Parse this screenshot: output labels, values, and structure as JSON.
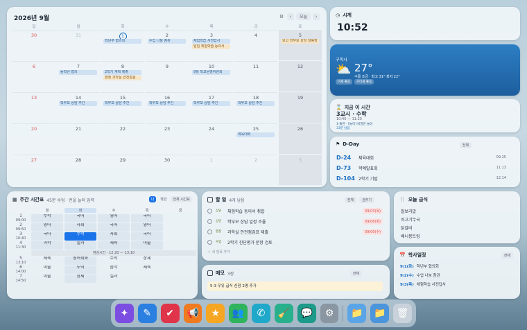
{
  "calendar": {
    "title": "2026년 9월",
    "today_label": "오늘",
    "weekdays": [
      "일",
      "월",
      "화",
      "수",
      "목",
      "금",
      "토"
    ],
    "weeks": [
      [
        {
          "n": "30",
          "dim": true
        },
        {
          "n": "31",
          "dim": true
        },
        {
          "n": "1",
          "today": true,
          "ev": [
            {
              "t": "학년부 협의회",
              "c": "b"
            }
          ]
        },
        {
          "n": "2",
          "ev": [
            {
              "t": "수업 나눔 참관",
              "c": "b"
            }
          ]
        },
        {
          "n": "3",
          "ev": [
            {
              "t": "체험학습 사전답사",
              "c": "b"
            },
            {
              "t": "답임 체험학습 동의서",
              "c": "o"
            }
          ]
        },
        {
          "n": "4"
        },
        {
          "n": "5",
          "ev": [
            {
              "t": "보고 학부모 상담 알림장",
              "c": "o"
            }
          ]
        }
      ],
      [
        {
          "n": "6"
        },
        {
          "n": "7",
          "ev": [
            {
              "t": "동학년 협의",
              "c": "b"
            }
          ]
        },
        {
          "n": "8",
          "ev": [
            {
              "t": "2학기 계획 제출",
              "c": "b"
            },
            {
              "t": "행정 과학실 안전점검",
              "c": "o"
            }
          ]
        },
        {
          "n": "9"
        },
        {
          "n": "10",
          "ev": [
            {
              "t": "9월 학교운영위원회",
              "c": "b"
            }
          ]
        },
        {
          "n": "11"
        },
        {
          "n": "12"
        }
      ],
      [
        {
          "n": "13"
        },
        {
          "n": "14",
          "ev": [
            {
              "t": "학부모 상담 주간",
              "c": "b"
            }
          ]
        },
        {
          "n": "15",
          "ev": [
            {
              "t": "학부모 상담 주간",
              "c": "b"
            }
          ]
        },
        {
          "n": "16",
          "ev": [
            {
              "t": "학부모 상담 주간",
              "c": "b"
            }
          ]
        },
        {
          "n": "17",
          "ev": [
            {
              "t": "학부모 상담 주간",
              "c": "b"
            }
          ]
        },
        {
          "n": "18",
          "ev": [
            {
              "t": "학부모 상담 주간",
              "c": "b"
            }
          ]
        },
        {
          "n": "19"
        }
      ],
      [
        {
          "n": "20"
        },
        {
          "n": "21"
        },
        {
          "n": "22"
        },
        {
          "n": "23"
        },
        {
          "n": "24"
        },
        {
          "n": "25",
          "ev": [
            {
              "t": "체육대회",
              "c": "b"
            }
          ]
        },
        {
          "n": "26"
        }
      ],
      [
        {
          "n": "27"
        },
        {
          "n": "28"
        },
        {
          "n": "29"
        },
        {
          "n": "30"
        },
        {
          "n": "1",
          "dim": true
        },
        {
          "n": "2",
          "dim": true
        },
        {
          "n": "3",
          "dim": true
        }
      ]
    ]
  },
  "clock": {
    "title": "시계",
    "time": "10:52"
  },
  "weather": {
    "city": "구미시",
    "temp": "27°",
    "desc": "구름 조금 · 최고 31° 최저 22°",
    "chips": [
      "미세 좋음",
      "초미세 좋음"
    ]
  },
  "now": {
    "title": "지금 이 시간",
    "period": "3교시 · 수학",
    "range": "10:40 — 11:25",
    "note": "1-통만 · [놀이] 비밀번 놀이",
    "remain": "33분 남음"
  },
  "dday": {
    "title": "D-Day",
    "btn": "전체",
    "items": [
      {
        "d": "D-24",
        "name": "체육대회",
        "date": "09.25"
      },
      {
        "d": "D-73",
        "name": "학예발표회",
        "date": "11.13"
      },
      {
        "d": "D-104",
        "name": "2학기 기말",
        "date": "12.14"
      }
    ]
  },
  "timetable": {
    "title": "주간 시간표",
    "sub": "45분 수업 · 컨을 눌러 입력",
    "tabs": [
      "나",
      "학반",
      "전체 시간표"
    ],
    "days": [
      "월",
      "화",
      "수",
      "목",
      "금"
    ],
    "periods": [
      "1",
      "2",
      "3",
      "4",
      "5",
      "6",
      "7"
    ],
    "times": [
      "09:00",
      "09:50",
      "10:40",
      "11:30",
      "13:10",
      "14:00",
      "14:50"
    ],
    "rows": [
      [
        "수학",
        "국어",
        "영어",
        "국어",
        ""
      ],
      [
        "영어",
        "사회",
        "국어",
        "영어",
        ""
      ],
      [
        "국어",
        "수학",
        "사회",
        "국어",
        ""
      ],
      [
        "과학",
        "실과",
        "체육",
        "미술",
        ""
      ],
      [
        "체육",
        "영어회화",
        "수학",
        "창체",
        ""
      ],
      [
        "미술",
        "도덕",
        "음악",
        "체육",
        ""
      ],
      [
        "미술",
        "창체",
        "실과",
        "",
        ""
      ]
    ],
    "lunch": "점심시간 · 12:20 — 13:10"
  },
  "todo": {
    "title": "할 일",
    "count": "4개 남음",
    "btns": [
      "전체",
      "검추기"
    ],
    "items": [
      {
        "tag": "상담",
        "text": "체험학습 동의서 취합",
        "date": "09/03(목)"
      },
      {
        "tag": "상담",
        "text": "학부모 상담 일정 조율",
        "date": "09/08(화)"
      },
      {
        "tag": "행정",
        "text": "과학실 안전점검표 제출",
        "date": "09/09(수)"
      },
      {
        "tag": "수업",
        "text": "2학기 진단평가 문항 검토",
        "date": ""
      }
    ],
    "add": "새 항목 추가"
  },
  "memo": {
    "title": "메모",
    "count": "3장",
    "btn": "전체",
    "text": "5-3 우유 급식 신청 2명 추가"
  },
  "meal": {
    "title": "오늘 급식",
    "items": [
      "찰보리밥",
      "쇠고기무국",
      "닭갈비",
      "배니봉트링"
    ]
  },
  "sched": {
    "title": "학사일정",
    "btn": "전체",
    "items": [
      {
        "date": "9/1(화)",
        "text": "학년부 협의회"
      },
      {
        "date": "9/2(수)",
        "text": "수업 나눔 참관"
      },
      {
        "date": "9/3(목)",
        "text": "체험학습 사전답사"
      }
    ]
  },
  "dock": {
    "apps": [
      {
        "name": "ai-app-icon",
        "glyph": "✦",
        "color": "#7b4de0"
      },
      {
        "name": "pen-app-icon",
        "glyph": "✎",
        "color": "#2a7fe0"
      },
      {
        "name": "checklist-app-icon",
        "glyph": "✔",
        "color": "#e0344a"
      },
      {
        "name": "megaphone-app-icon",
        "glyph": "📢",
        "color": "#f07a20"
      },
      {
        "name": "star-app-icon",
        "glyph": "★",
        "color": "#f5a623"
      },
      {
        "name": "people-app-icon",
        "glyph": "👥",
        "color": "#2fb35c"
      },
      {
        "name": "phone-app-icon",
        "glyph": "✆",
        "color": "#1fa8c9"
      },
      {
        "name": "clean-app-icon",
        "glyph": "🧹",
        "color": "#28b08c"
      },
      {
        "name": "chat-app-icon",
        "glyph": "💬",
        "color": "#1c9a8a"
      },
      {
        "name": "settings-app-icon",
        "glyph": "⚙",
        "color": "#8a96a1"
      },
      {
        "name": "folder-app-icon",
        "glyph": "📁",
        "color": "#5aa5e8"
      },
      {
        "name": "folder2-app-icon",
        "glyph": "📁",
        "color": "#4a95dc"
      },
      {
        "name": "trash-app-icon",
        "glyph": "🗑",
        "color": "#c9d2da"
      }
    ]
  }
}
